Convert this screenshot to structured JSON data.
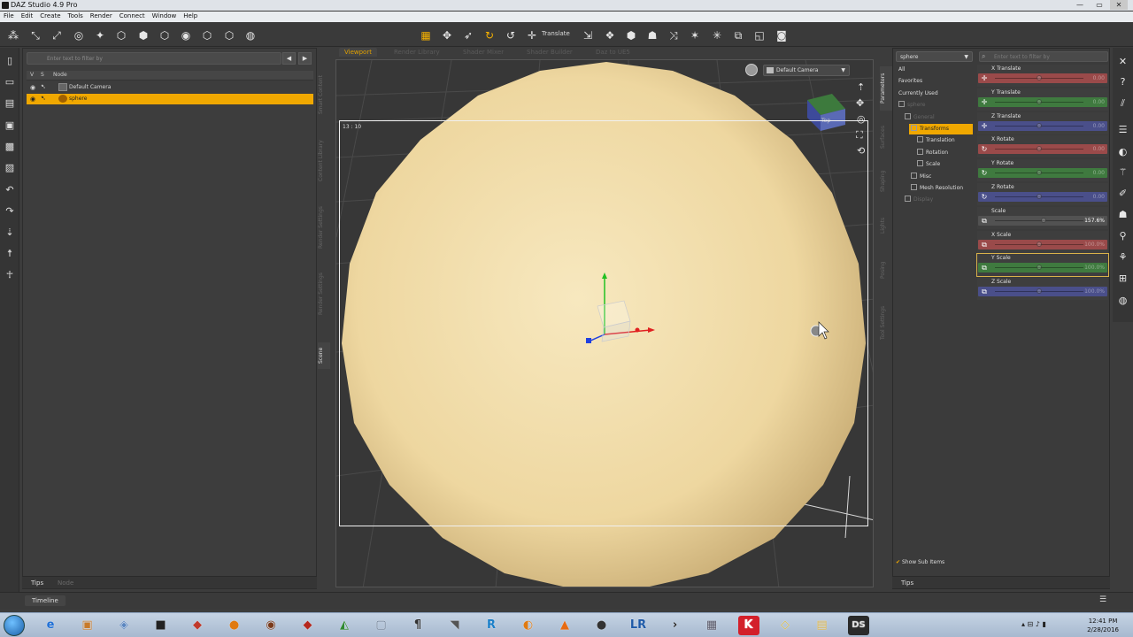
{
  "window": {
    "title": "DAZ Studio 4.9 Pro"
  },
  "menu": [
    "File",
    "Edit",
    "Create",
    "Tools",
    "Render",
    "Connect",
    "Window",
    "Help"
  ],
  "toolbar": {
    "active_tool_label": "Translate"
  },
  "scene": {
    "filter_placeholder": "Enter text to filter by",
    "col_v": "V",
    "col_s": "S",
    "col_node": "Node",
    "nodes": [
      {
        "label": "Default Camera",
        "selected": false
      },
      {
        "label": "sphere",
        "selected": true
      }
    ],
    "bottom_tabs": [
      "Tips",
      "Node"
    ]
  },
  "left_vtabs": [
    "Smart Content",
    "Content Library",
    "Render Settings",
    "Scene"
  ],
  "viewport": {
    "tabs": [
      "Viewport",
      "Render Library",
      "Shader Mixer",
      "Shader Builder",
      "Daz to UE5"
    ],
    "camera": "Default Camera",
    "aspect_label": "13 : 10",
    "cube_label": "Top"
  },
  "right_vtabs": [
    "Parameters",
    "Surfaces",
    "Shaping",
    "Lights",
    "Posing",
    "Tool Settings",
    "Content"
  ],
  "params": {
    "node": "sphere",
    "filter_placeholder": "Enter text to filter by",
    "tree": [
      {
        "label": "All",
        "indent": 0,
        "style": "normal"
      },
      {
        "label": "Favorites",
        "indent": 0,
        "style": "normal"
      },
      {
        "label": "Currently Used",
        "indent": 0,
        "style": "normal"
      },
      {
        "label": "sphere",
        "indent": 0,
        "style": "dim"
      },
      {
        "label": "General",
        "indent": 1,
        "style": "dim"
      },
      {
        "label": "Transforms",
        "indent": 2,
        "style": "hl"
      },
      {
        "label": "Translation",
        "indent": 3,
        "style": "normal"
      },
      {
        "label": "Rotation",
        "indent": 3,
        "style": "normal"
      },
      {
        "label": "Scale",
        "indent": 3,
        "style": "normal"
      },
      {
        "label": "Misc",
        "indent": 2,
        "style": "normal"
      },
      {
        "label": "Mesh Resolution",
        "indent": 2,
        "style": "normal"
      },
      {
        "label": "Display",
        "indent": 1,
        "style": "dim"
      }
    ],
    "sliders": [
      {
        "name": "X Translate",
        "value": "0.00",
        "color": "#9a4a4a",
        "icon": "move"
      },
      {
        "name": "Y Translate",
        "value": "0.00",
        "color": "#3f7a3f",
        "icon": "move"
      },
      {
        "name": "Z Translate",
        "value": "0.00",
        "color": "#4a4f8a",
        "icon": "move"
      },
      {
        "name": "X Rotate",
        "value": "0.00",
        "color": "#9a4a4a",
        "icon": "rotate"
      },
      {
        "name": "Y Rotate",
        "value": "0.00",
        "color": "#3f7a3f",
        "icon": "rotate"
      },
      {
        "name": "Z Rotate",
        "value": "0.00",
        "color": "#4a4f8a",
        "icon": "rotate"
      },
      {
        "name": "Scale",
        "value": "157.6%",
        "color": "#525252",
        "icon": "scale",
        "bright": true,
        "level": 0.55
      },
      {
        "name": "X Scale",
        "value": "100.0%",
        "color": "#9a4a4a",
        "icon": "scale"
      },
      {
        "name": "Y Scale",
        "value": "100.0%",
        "color": "#3f7a3f",
        "icon": "scale",
        "outlined": true
      },
      {
        "name": "Z Scale",
        "value": "100.0%",
        "color": "#4a4f8a",
        "icon": "scale"
      }
    ],
    "show_sub_items": "Show Sub Items",
    "bottom_tab": "Tips"
  },
  "timeline": {
    "label": "Timeline"
  },
  "taskbar": {
    "time": "12:41 PM",
    "date": "2/28/2016",
    "apps": [
      {
        "glyph": "e",
        "color": "#1e6fd6"
      },
      {
        "glyph": "▣",
        "color": "#c87a2a"
      },
      {
        "glyph": "◈",
        "color": "#5a86c0"
      },
      {
        "glyph": "■",
        "color": "#222"
      },
      {
        "glyph": "◆",
        "color": "#c0392b"
      },
      {
        "glyph": "●",
        "color": "#e07a10"
      },
      {
        "glyph": "◉",
        "color": "#7a3a1a"
      },
      {
        "glyph": "◆",
        "color": "#b5281e"
      },
      {
        "glyph": "◭",
        "color": "#2f8a2f"
      },
      {
        "glyph": "▢",
        "color": "#6e7f95"
      },
      {
        "glyph": "¶",
        "color": "#333"
      },
      {
        "glyph": "◥",
        "color": "#555"
      },
      {
        "glyph": "R",
        "color": "#1a7fc8"
      },
      {
        "glyph": "◐",
        "color": "#e07a10"
      },
      {
        "glyph": "▲",
        "color": "#e86a10"
      },
      {
        "glyph": "●",
        "color": "#333"
      },
      {
        "glyph": "LR",
        "color": "#1e5aa8"
      },
      {
        "glyph": "›",
        "color": "#222"
      },
      {
        "glyph": "▦",
        "color": "#556"
      },
      {
        "glyph": "K",
        "color": "#d31f2a"
      },
      {
        "glyph": "◇",
        "color": "#d6b84a"
      },
      {
        "glyph": "▤",
        "color": "#d9b24a"
      },
      {
        "glyph": "DS",
        "color": "#2a2a2a"
      }
    ]
  },
  "colors": {
    "accent": "#f0a800",
    "sphere": "#f0dca8",
    "viewport_bg": "#373737"
  }
}
